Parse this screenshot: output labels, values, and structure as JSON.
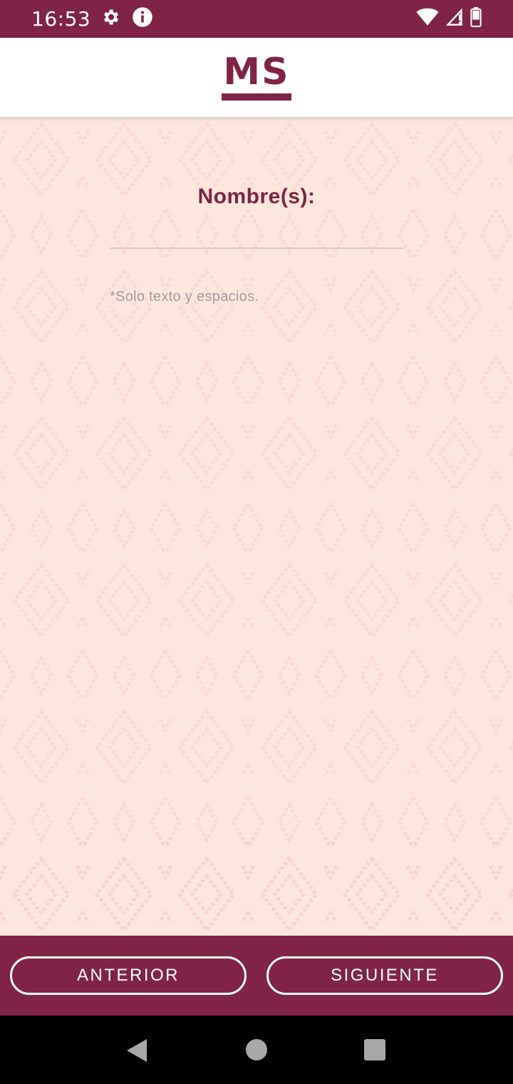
{
  "status_bar": {
    "time": "16:53",
    "icons": [
      "settings-icon",
      "info-icon",
      "wifi-icon",
      "signal-icon",
      "battery-icon"
    ]
  },
  "header": {
    "logo_text": "MS"
  },
  "form": {
    "field_label": "Nombre(s):",
    "input_value": "",
    "input_placeholder": "",
    "hint": "*Solo texto y espacios."
  },
  "buttons": {
    "previous": "ANTERIOR",
    "next": "SIGUIENTE"
  },
  "system_nav": {
    "icons": [
      "back-icon",
      "home-icon",
      "recents-icon"
    ]
  },
  "colors": {
    "brand": "#7f2446",
    "background": "#fde7dc",
    "pattern": "#f7c3cf",
    "hint_text": "#a09b9e"
  }
}
